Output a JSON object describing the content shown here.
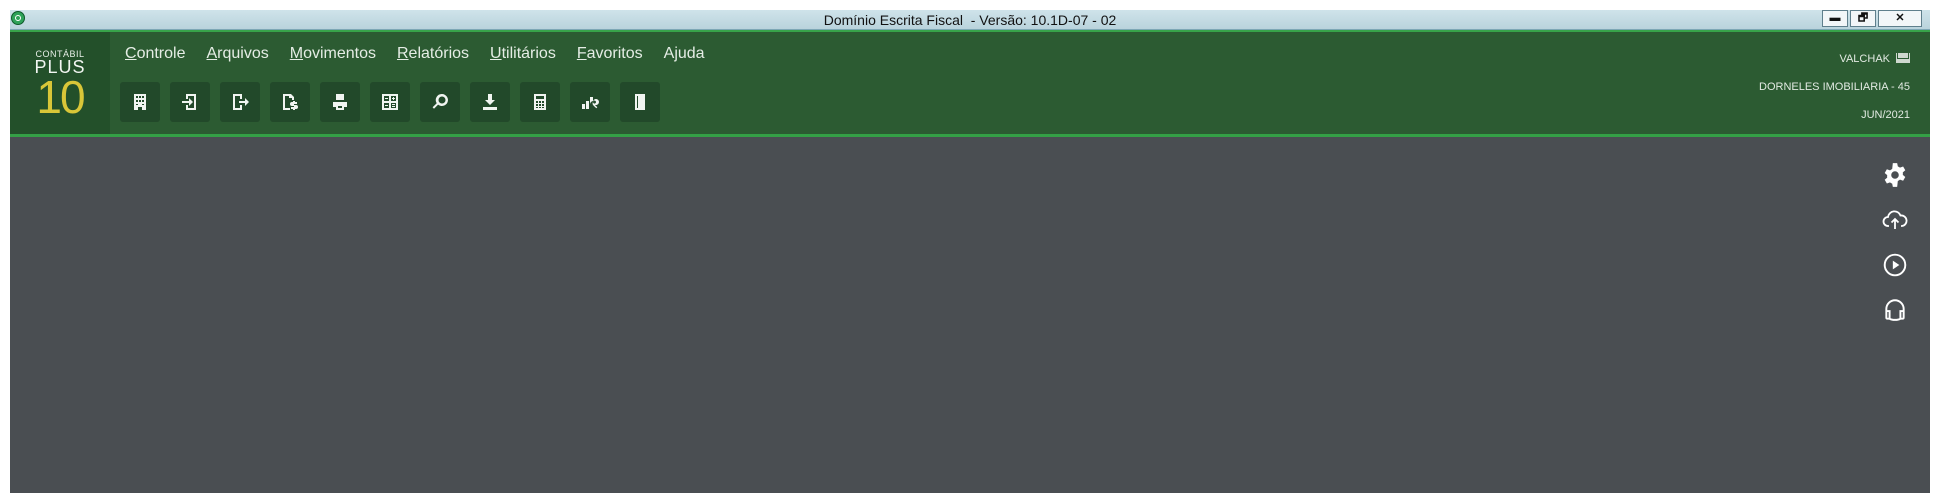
{
  "window": {
    "title": "Domínio Escrita Fiscal  - Versão: 10.1D-07 - 02",
    "controls": {
      "minimize": "▬",
      "restore": "🗗",
      "close": "✕"
    }
  },
  "logo": {
    "top": "CONTÁBIL",
    "middle": "PLUS",
    "number": "10"
  },
  "menu": [
    {
      "underline": "C",
      "rest": "ontrole"
    },
    {
      "underline": "A",
      "rest": "rquivos"
    },
    {
      "underline": "M",
      "rest": "ovimentos"
    },
    {
      "underline": "R",
      "rest": "elatórios"
    },
    {
      "underline": "U",
      "rest": "tilitários"
    },
    {
      "underline": "F",
      "rest": "avoritos"
    },
    {
      "underline": "",
      "rest": "Ajuda"
    }
  ],
  "toolbar_icons": [
    "building-icon",
    "entry-icon",
    "exit-icon",
    "tax-document-icon",
    "printer-icon",
    "calculator-grid-icon",
    "search-icon",
    "download-icon",
    "calculator-icon",
    "chart-search-icon",
    "exit-door-icon"
  ],
  "user": {
    "name": "VALCHAK",
    "company": "DORNELES IMOBILIARIA - 45",
    "period": "JUN/2021"
  },
  "side_icons": [
    "gear-icon",
    "cloud-upload-icon",
    "play-circle-icon",
    "headset-icon"
  ],
  "colors": {
    "header_bg": "#2c5b32",
    "header_accent": "#38a34a",
    "workspace_bg": "#4a4e52",
    "logo_number": "#d9c638"
  }
}
